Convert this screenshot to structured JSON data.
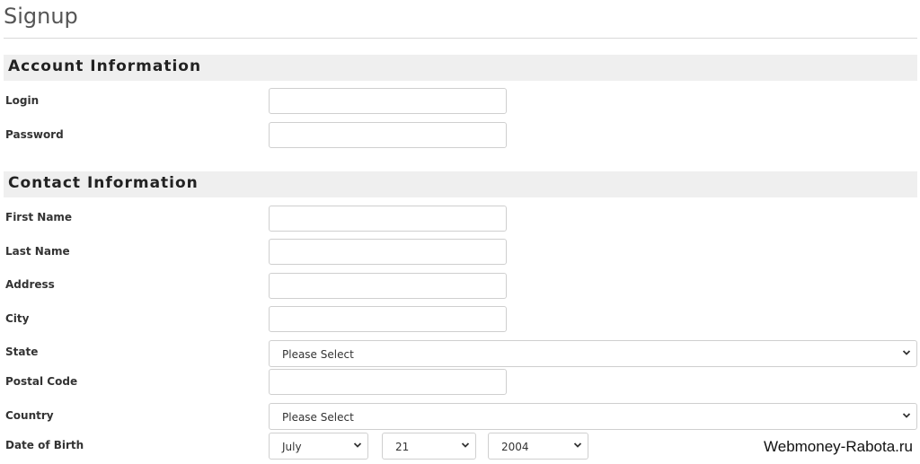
{
  "page": {
    "title": "Signup"
  },
  "account_section": {
    "heading": "Account Information",
    "fields": [
      {
        "label": "Login",
        "value": ""
      },
      {
        "label": "Password",
        "value": ""
      }
    ]
  },
  "contact_section": {
    "heading": "Contact Information",
    "first_name": {
      "label": "First Name",
      "value": ""
    },
    "last_name": {
      "label": "Last Name",
      "value": ""
    },
    "address": {
      "label": "Address",
      "value": ""
    },
    "city": {
      "label": "City",
      "value": ""
    },
    "state": {
      "label": "State",
      "selected": "Please Select"
    },
    "postal_code": {
      "label": "Postal Code",
      "value": ""
    },
    "country": {
      "label": "Country",
      "selected": "Please Select"
    },
    "date_of_birth": {
      "label": "Date of Birth",
      "month": "July",
      "day": "21",
      "year": "2004"
    }
  },
  "watermark": "Webmoney-Rabota.ru"
}
